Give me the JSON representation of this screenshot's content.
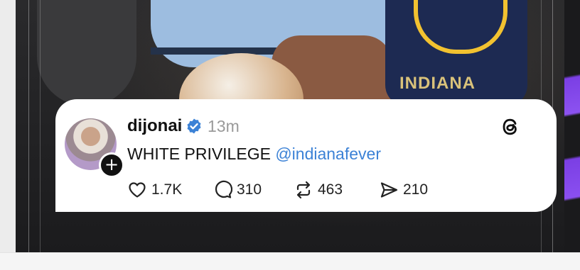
{
  "photo": {
    "jersey_text": "INDIANA"
  },
  "post": {
    "username": "dijonai",
    "time": "13m",
    "text": "WHITE PRIVILEGE",
    "mention": "@indianafever",
    "likes": "1.7K",
    "replies": "310",
    "reposts": "463",
    "shares": "210",
    "icons": {
      "like": "heart-icon",
      "reply": "comment-bubble-icon",
      "repost": "repost-arrows-icon",
      "share": "send-icon",
      "verified": "verified-badge-icon",
      "follow": "plus-icon",
      "brand": "threads-logo-icon"
    }
  },
  "colors": {
    "mention": "#3c82d6",
    "verified": "#3c82d6",
    "accent_band": "#7b3fe4"
  }
}
